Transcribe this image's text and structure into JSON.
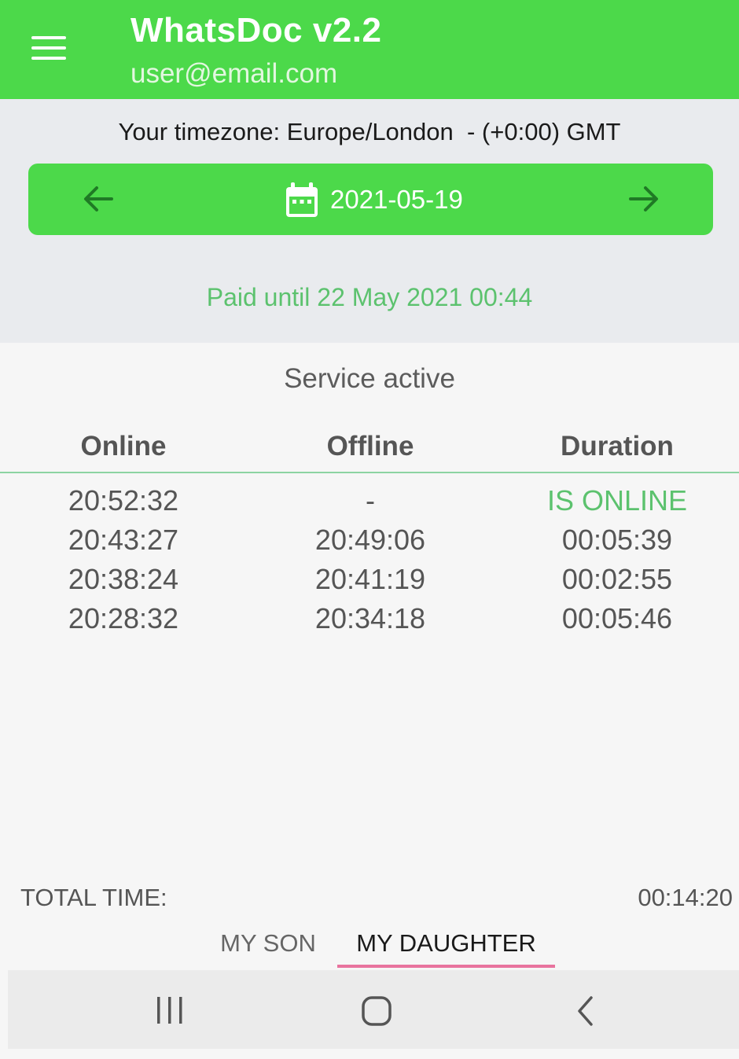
{
  "header": {
    "title": "WhatsDoc v2.2",
    "email": "user@email.com",
    "background_color": "#4cd94a"
  },
  "timezone_text": "Your timezone: Europe/London  - (+0:00) GMT",
  "date_nav": {
    "date": "2021-05-19",
    "prev_icon": "arrow-left-icon",
    "next_icon": "arrow-right-icon",
    "calendar_icon": "calendar-icon"
  },
  "paid_until": "Paid until 22 May 2021 00:44",
  "service_status": "Service active",
  "table": {
    "columns": [
      "Online",
      "Offline",
      "Duration"
    ],
    "rows": [
      {
        "online": "20:52:32",
        "offline": "-",
        "duration": "IS ONLINE"
      },
      {
        "online": "20:43:27",
        "offline": "20:49:06",
        "duration": "00:05:39"
      },
      {
        "online": "20:38:24",
        "offline": "20:41:19",
        "duration": "00:02:55"
      },
      {
        "online": "20:28:32",
        "offline": "20:34:18",
        "duration": "00:05:46"
      }
    ]
  },
  "total": {
    "label": "TOTAL TIME:",
    "value": "00:14:20"
  },
  "tabs": {
    "items": [
      "MY SON",
      "MY DAUGHTER"
    ],
    "selected": "MY DAUGHTER",
    "indicator_color": "#e8739e"
  },
  "nav_bar": {
    "icons": [
      "recent-apps-icon",
      "home-icon",
      "back-icon"
    ]
  }
}
